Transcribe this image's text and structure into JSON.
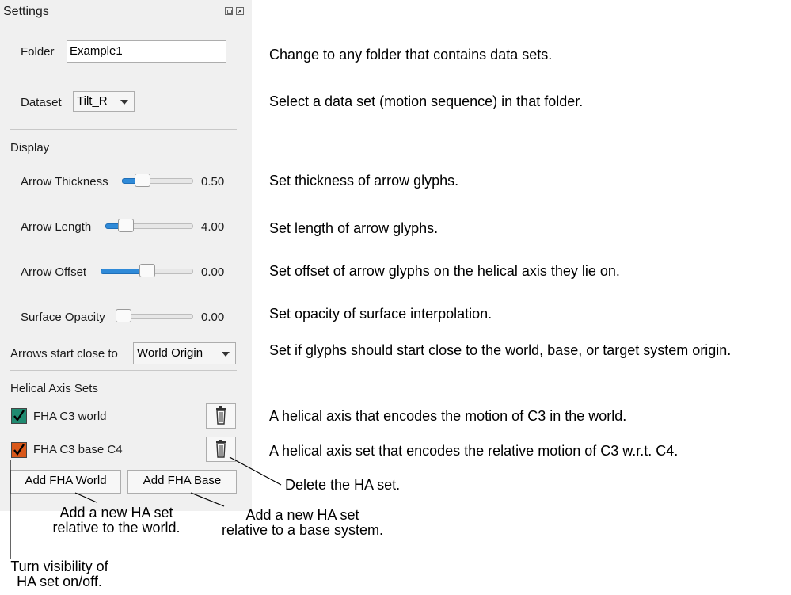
{
  "panel": {
    "title": "Settings",
    "folder_label": "Folder",
    "folder_value": "Example1",
    "dataset_label": "Dataset",
    "dataset_value": "Tilt_R",
    "display_heading": "Display",
    "sliders": [
      {
        "label": "Arrow Thickness",
        "value_text": "0.50",
        "level": 0.25
      },
      {
        "label": "Arrow Length",
        "value_text": "4.00",
        "level": 0.22
      },
      {
        "label": "Arrow Offset",
        "value_text": "0.00",
        "level": 0.5
      },
      {
        "label": "Surface Opacity",
        "value_text": "0.00",
        "level": 0.0
      }
    ],
    "arrows_start_label": "Arrows start close to",
    "arrows_start_value": "World Origin",
    "helical_heading": "Helical Axis Sets",
    "ha_sets": [
      {
        "label": "FHA C3 world",
        "checked": true,
        "color": "#1f8a70"
      },
      {
        "label": "FHA C3 base C4",
        "checked": true,
        "color": "#d9581a"
      }
    ],
    "add_world_button": "Add FHA World",
    "add_base_button": "Add FHA Base",
    "accent_color": "#2f8ad8"
  },
  "descriptions": {
    "folder": "Change to any folder that contains data sets.",
    "dataset": "Select a data set (motion sequence) in that folder.",
    "thickness": "Set thickness of arrow glyphs.",
    "length": "Set length of arrow glyphs.",
    "offset": "Set offset of arrow glyphs on the helical axis they lie on.",
    "opacity": "Set opacity of surface interpolation.",
    "start": "Set if glyphs should start close to the world, base, or target system origin.",
    "ha_world": "A helical axis that encodes the motion of C3 in the world.",
    "ha_base": "A helical axis set that encodes the relative motion of C3 w.r.t. C4."
  },
  "annotations": {
    "delete": "Delete the HA set.",
    "add_world_1": "Add a new HA set",
    "add_world_2": "relative to the world.",
    "add_base_1": "Add a new HA set",
    "add_base_2": "relative to a base system.",
    "visibility_1": "Turn visibility of",
    "visibility_2": "HA set on/off."
  }
}
